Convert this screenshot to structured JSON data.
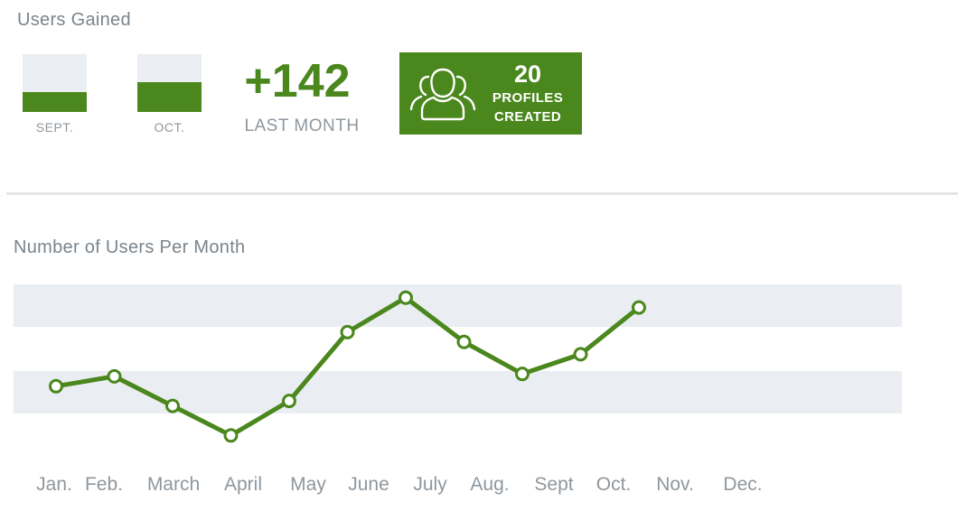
{
  "users_gained": {
    "title": "Users Gained",
    "months": [
      {
        "label": "SEPT.",
        "fill_fraction": 0.35
      },
      {
        "label": "OCT.",
        "fill_fraction": 0.52
      }
    ],
    "delta": "+142",
    "delta_caption": "LAST MONTH",
    "profiles": {
      "count": "20",
      "line1": "PROFILES",
      "line2": "CREATED",
      "icon": "users-icon"
    }
  },
  "colors": {
    "accent": "#4a871d",
    "band": "#eaedf1",
    "muted": "#8e979e"
  },
  "chart_data": {
    "type": "line",
    "title": "Number of Users Per Month",
    "categories": [
      "Jan.",
      "Feb.",
      "March",
      "April",
      "May",
      "June",
      "July",
      "Aug.",
      "Sept",
      "Oct.",
      "Nov.",
      "Dec."
    ],
    "values": [
      52,
      56,
      44,
      32,
      46,
      74,
      88,
      70,
      57,
      65,
      84,
      null,
      null
    ],
    "ylim": [
      20,
      100
    ],
    "grid": "alternating horizontal bands"
  }
}
